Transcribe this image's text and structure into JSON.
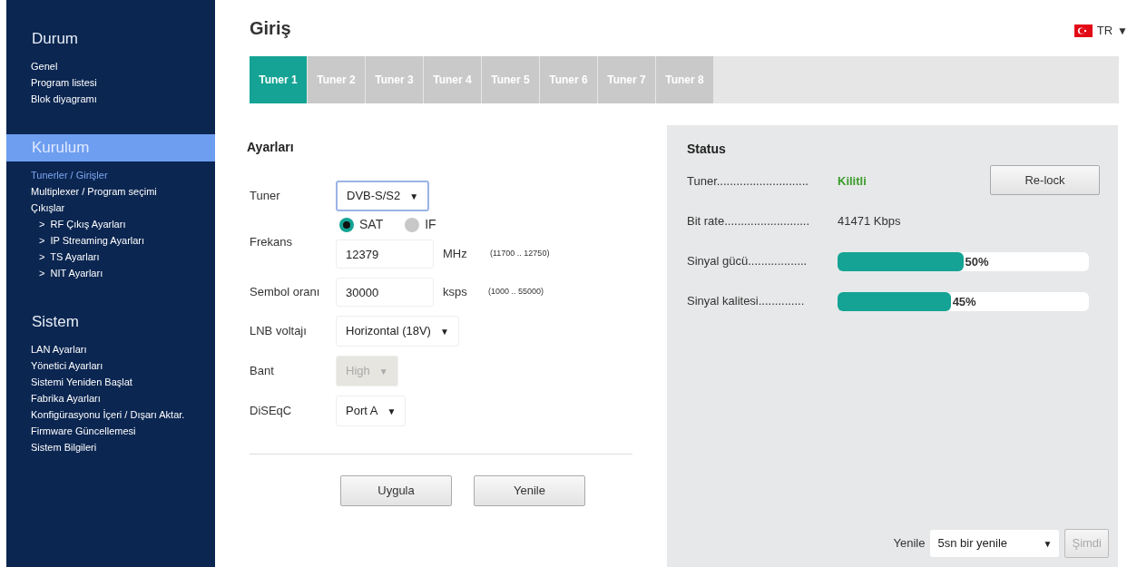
{
  "sidebar": {
    "sections": [
      {
        "title": "Durum",
        "selected": false,
        "items": [
          {
            "label": "Genel",
            "selected": false
          },
          {
            "label": "Program listesi",
            "selected": false
          },
          {
            "label": "Blok diyagramı",
            "selected": false
          }
        ]
      },
      {
        "title": "Kurulum",
        "selected": true,
        "items": [
          {
            "label": "Tunerler / Girişler",
            "selected": true
          },
          {
            "label": "Multiplexer / Program seçimi",
            "selected": false
          },
          {
            "label": "Çıkışlar",
            "selected": false,
            "children": [
              {
                "label": "RF Çıkış Ayarları",
                "marker": ">",
                "selected": false
              },
              {
                "label": "IP Streaming Ayarları",
                "marker": ">",
                "selected": false
              },
              {
                "label": "TS Ayarları",
                "marker": ">",
                "selected": false
              },
              {
                "label": "NIT Ayarları",
                "marker": ">",
                "selected": false
              }
            ]
          }
        ]
      },
      {
        "title": "Sistem",
        "selected": false,
        "items": [
          {
            "label": "LAN Ayarları",
            "selected": false
          },
          {
            "label": "Yönetici Ayarları",
            "selected": false
          },
          {
            "label": "Sistemi Yeniden Başlat",
            "selected": false
          },
          {
            "label": "Fabrika Ayarları",
            "selected": false
          },
          {
            "label": "Konfigürasyonu İçeri / Dışarı Aktar.",
            "selected": false
          },
          {
            "label": "Firmware Güncellemesi",
            "selected": false
          },
          {
            "label": "Sistem Bilgileri",
            "selected": false
          }
        ]
      }
    ]
  },
  "header": {
    "title": "Giriş",
    "language": "TR",
    "caret": "▼"
  },
  "tabs": [
    {
      "label": "Tuner 1",
      "selected": true
    },
    {
      "label": "Tuner 2",
      "selected": false
    },
    {
      "label": "Tuner 3",
      "selected": false
    },
    {
      "label": "Tuner 4",
      "selected": false
    },
    {
      "label": "Tuner 5",
      "selected": false
    },
    {
      "label": "Tuner 6",
      "selected": false
    },
    {
      "label": "Tuner 7",
      "selected": false
    },
    {
      "label": "Tuner 8",
      "selected": false
    }
  ],
  "settings": {
    "title": "Ayarları",
    "fields": [
      {
        "kind": "select",
        "label": "Tuner",
        "value": "DVB-S/S2",
        "focused": true,
        "disabled": false,
        "caret": "▼"
      },
      {
        "kind": "frequency",
        "label": "Frekans",
        "options": [
          {
            "label": "SAT",
            "selected": true
          },
          {
            "label": "IF",
            "selected": false
          }
        ],
        "value": "12379",
        "unit": "MHz",
        "range": "(11700 .. 12750)"
      },
      {
        "kind": "input",
        "label": "Sembol oranı",
        "value": "30000",
        "unit": "ksps",
        "range": "(1000 .. 55000)"
      },
      {
        "kind": "select",
        "label": "LNB voltajı",
        "value": "Horizontal (18V)",
        "focused": false,
        "disabled": false,
        "caret": "▼"
      },
      {
        "kind": "select",
        "label": "Bant",
        "value": "High",
        "focused": false,
        "disabled": true,
        "caret": "▼"
      },
      {
        "kind": "select",
        "label": "DiSEqC",
        "value": "Port A",
        "focused": false,
        "disabled": false,
        "caret": "▼"
      }
    ],
    "buttons": [
      "Uygula",
      "Yenile"
    ]
  },
  "status": {
    "title": "Status",
    "rows": [
      {
        "kind": "text",
        "label": "Tuner............................",
        "value": "Kilitli",
        "color": "#3a9c2a"
      },
      {
        "kind": "text",
        "label": "Bit rate..........................",
        "value": "41471 Kbps",
        "color": "#333333"
      },
      {
        "kind": "meter",
        "label": "Sinyal gücü..................",
        "level": 0.5,
        "reading": "50%"
      },
      {
        "kind": "meter",
        "label": "Sinyal kalitesi..............",
        "level": 0.45,
        "reading": "45%"
      }
    ],
    "relock_button": "Re-lock",
    "refresh": {
      "label": "Yenile",
      "value": "5sn bir yenile",
      "caret": "▼",
      "button": "Şimdi",
      "button_disabled": true
    }
  }
}
